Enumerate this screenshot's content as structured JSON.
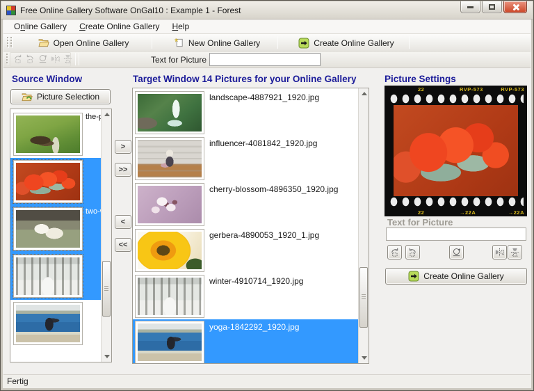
{
  "window": {
    "title": "Free Online Gallery Software OnGal10 : Example 1 - Forest"
  },
  "menu": {
    "items": [
      {
        "pre": "O",
        "key": "n",
        "post": "line Gallery"
      },
      {
        "pre": "",
        "key": "C",
        "post": "reate Online Gallery"
      },
      {
        "pre": "",
        "key": "H",
        "post": "elp"
      }
    ]
  },
  "toolbar": {
    "open_label": "Open Online Gallery",
    "new_label": "New Online Gallery",
    "create_label": "Create Online Gallery"
  },
  "picture_toolbar": {
    "label": "Text for Picture",
    "value": ""
  },
  "source": {
    "heading": "Source Window",
    "picture_selection_label": "Picture Selection",
    "items": [
      {
        "label": "the-pa",
        "photo": "farm",
        "selected": false
      },
      {
        "label": "",
        "photo": "tulips",
        "selected": true
      },
      {
        "label": "two-w",
        "photo": "swans",
        "selected": true
      },
      {
        "label": "",
        "photo": "winter",
        "selected": true
      },
      {
        "label": "",
        "photo": "yoga",
        "selected": false
      }
    ]
  },
  "transfer": {
    "move_selected_right": ">",
    "move_all_right": ">>",
    "move_selected_left": "<",
    "move_all_left": "<<"
  },
  "target": {
    "heading": "Target Window 14 Pictures for your Online Gallery",
    "items": [
      {
        "filename": "landscape-4887921_1920.jpg",
        "photo": "waterfall",
        "selected": false
      },
      {
        "filename": "influencer-4081842_1920.jpg",
        "photo": "influencer",
        "selected": false
      },
      {
        "filename": "cherry-blossom-4896350_1920.jpg",
        "photo": "blossom",
        "selected": false
      },
      {
        "filename": "gerbera-4890053_1920_1.jpg",
        "photo": "gerbera",
        "selected": false
      },
      {
        "filename": "winter-4910714_1920.jpg",
        "photo": "winter",
        "selected": false
      },
      {
        "filename": "yoga-1842292_1920.jpg",
        "photo": "yoga",
        "selected": true
      }
    ]
  },
  "settings": {
    "heading": "Picture Settings",
    "preview_photo": "tulips",
    "film_marks": {
      "top": [
        "22",
        "RVP-573",
        "RVP-573"
      ],
      "bottom": [
        "22",
        "→22A",
        "→22A"
      ]
    },
    "text_label": "Text for Picture",
    "text_value": "",
    "create_label": "Create Online Gallery"
  },
  "status": {
    "text": "Fertig"
  },
  "colors": {
    "selection": "#3399ff",
    "heading": "#1b1b99",
    "button_green": "#b8da5a",
    "film_text": "#d8b91c"
  }
}
